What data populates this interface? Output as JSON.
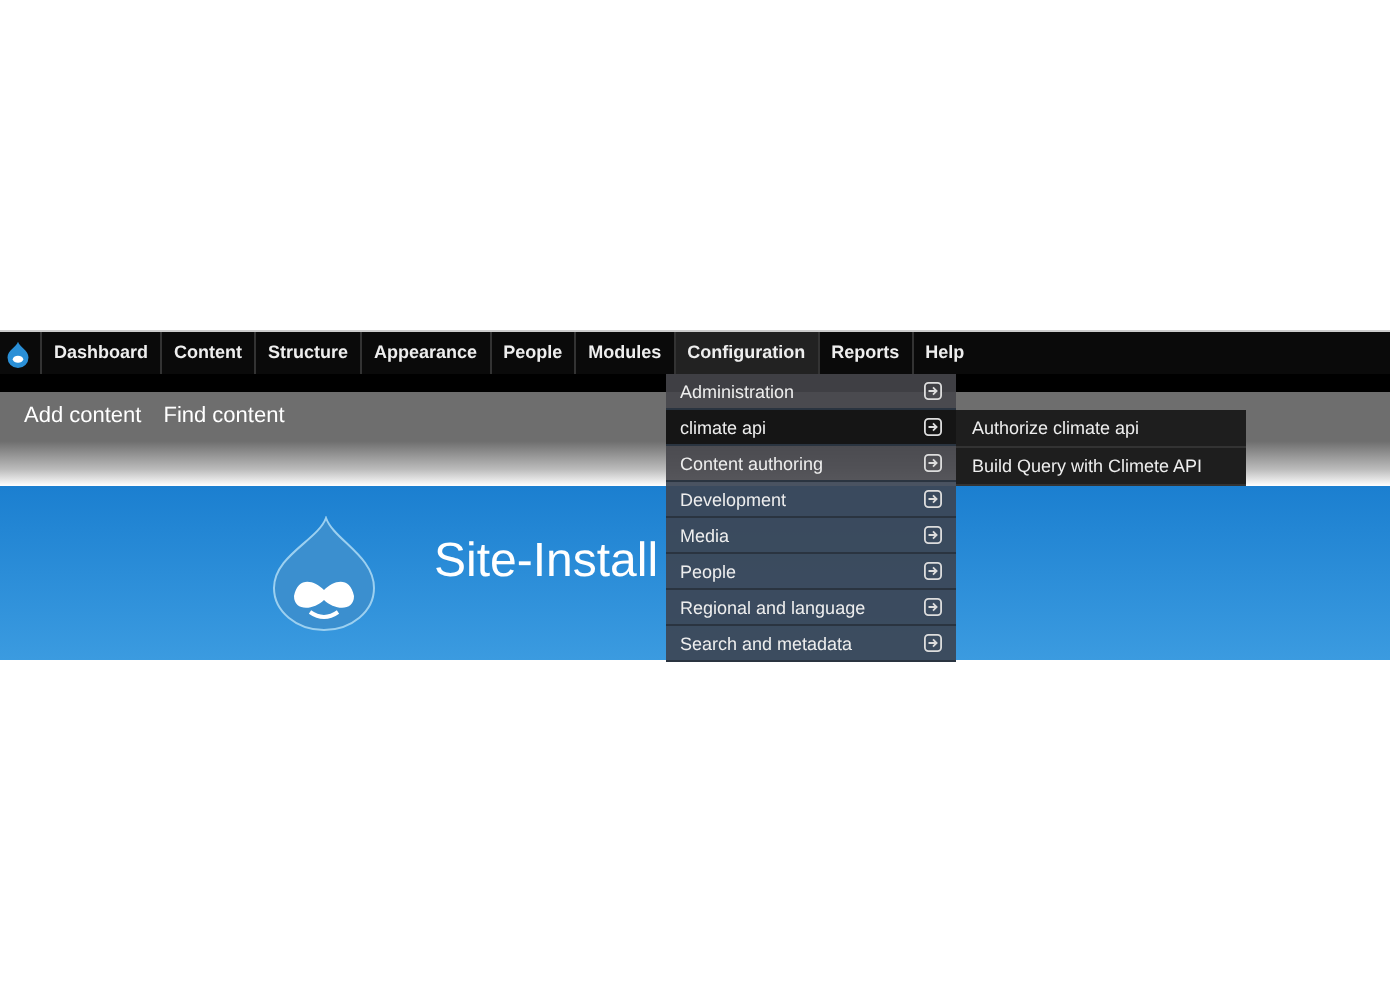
{
  "toolbar": {
    "items": [
      {
        "label": "Dashboard",
        "selected": false
      },
      {
        "label": "Content",
        "selected": false
      },
      {
        "label": "Structure",
        "selected": false
      },
      {
        "label": "Appearance",
        "selected": false
      },
      {
        "label": "People",
        "selected": false
      },
      {
        "label": "Modules",
        "selected": false
      },
      {
        "label": "Configuration",
        "selected": true
      },
      {
        "label": "Reports",
        "selected": false
      },
      {
        "label": "Help",
        "selected": false
      }
    ]
  },
  "shortcuts": [
    "Add content",
    "Find content"
  ],
  "header": {
    "site_name": "Site-Install"
  },
  "dropdown": {
    "items": [
      {
        "label": "Administration",
        "selected": false
      },
      {
        "label": "climate api",
        "selected": true
      },
      {
        "label": "Content authoring",
        "selected": false
      },
      {
        "label": "Development",
        "selected": false
      },
      {
        "label": "Media",
        "selected": false
      },
      {
        "label": "People",
        "selected": false
      },
      {
        "label": "Regional and language",
        "selected": false
      },
      {
        "label": "Search and metadata",
        "selected": false
      }
    ],
    "submenu": [
      "Authorize climate api",
      "Build Query with Climete API"
    ]
  }
}
